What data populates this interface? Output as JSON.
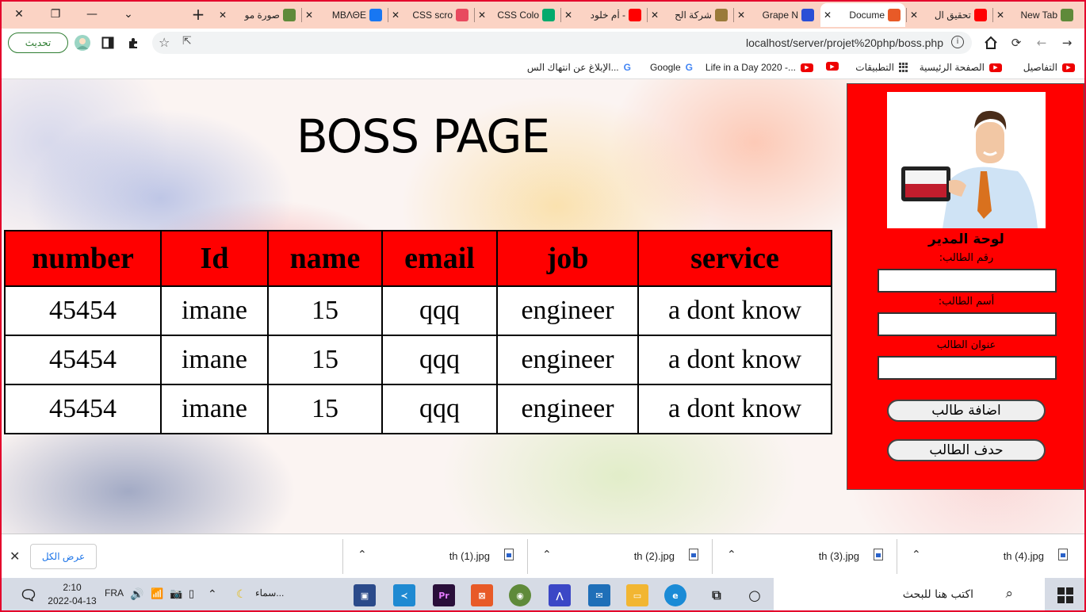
{
  "browser": {
    "tabs": [
      {
        "label": "New Tab",
        "icon": "chrome-icon",
        "color": "#5f8a3a"
      },
      {
        "label": "تحقيق ال",
        "icon": "youtube-icon",
        "color": "#ff0000"
      },
      {
        "label": "Docume",
        "icon": "xampp-icon",
        "color": "#e85a27",
        "active": true
      },
      {
        "label": "Grape N",
        "icon": "grape-icon",
        "color": "#2a4fd6"
      },
      {
        "label": "شركة الح",
        "icon": "company-icon",
        "color": "#9a7a3a"
      },
      {
        "label": "أم خلود -",
        "icon": "youtube-icon",
        "color": "#ff0000"
      },
      {
        "label": "CSS Colo",
        "icon": "w3schools-icon",
        "color": "#04aa6d"
      },
      {
        "label": "CSS scro",
        "icon": "css-icon",
        "color": "#e84a5f"
      },
      {
        "label": "MΒΛΘΕ",
        "icon": "facebook-icon",
        "color": "#1877f2"
      },
      {
        "label": "صورة مو",
        "icon": "chrome-icon",
        "color": "#5f8a3a"
      }
    ],
    "reload_chip": "تحديث",
    "url": "localhost/server/projet%20php/boss.php",
    "bookmarks": [
      {
        "label": "التفاصيل",
        "icon": "youtube-icon"
      },
      {
        "label": "الصفحة الرئيسية",
        "icon": "youtube-icon"
      },
      {
        "label": "التطبيقات",
        "icon": "apps-icon"
      },
      {
        "label": "",
        "icon": "youtube-icon"
      },
      {
        "label": "Life in a Day 2020 -...",
        "icon": "youtube-icon"
      },
      {
        "label": "Google",
        "icon": "google-icon"
      },
      {
        "label": "الإبلاغ عن انتهاك الس...",
        "icon": "google-icon"
      }
    ]
  },
  "page": {
    "title": "BOSS PAGE",
    "table": {
      "headers": [
        "number",
        "Id",
        "name",
        "email",
        "job",
        "service"
      ],
      "rows": [
        [
          "45454",
          "imane",
          "15",
          "qqq",
          "engineer",
          "a dont know"
        ],
        [
          "45454",
          "imane",
          "15",
          "qqq",
          "engineer",
          "a dont know"
        ],
        [
          "45454",
          "imane",
          "15",
          "qqq",
          "engineer",
          "a dont know"
        ]
      ]
    },
    "panel": {
      "title": "لوحة المدير",
      "label_number": "رقم الطالب:",
      "label_name": "أسم الطالب:",
      "label_address": "عنوان الطالب",
      "add_button": "اضافة طالب",
      "delete_button": "حدف الطالب"
    }
  },
  "downloads": {
    "show_all": "عرض الكل",
    "items": [
      "th (1).jpg",
      "th (2).jpg",
      "th (3).jpg",
      "th (4).jpg"
    ]
  },
  "taskbar": {
    "search_placeholder": "اكتب هنا للبحث",
    "time": "2:10",
    "date": "2022-04-13",
    "lang": "FRA",
    "weather": "سماء..."
  }
}
